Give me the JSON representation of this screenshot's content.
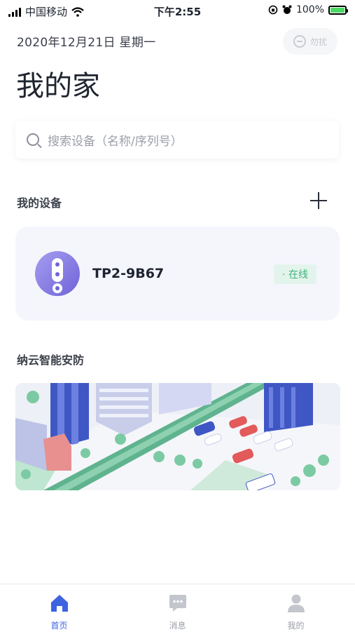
{
  "status_bar": {
    "carrier": "中国移动",
    "time": "下午2:55",
    "battery": "100%"
  },
  "header": {
    "date": "2020年12月21日  星期一",
    "dnd_label": "勿扰",
    "title": "我的家"
  },
  "search": {
    "placeholder": "搜索设备（名称/序列号）"
  },
  "devices_section": {
    "title": "我的设备",
    "devices": [
      {
        "name": "TP2-9B67",
        "status": "· 在线"
      }
    ]
  },
  "security_section": {
    "title": "纳云智能安防"
  },
  "tab_bar": {
    "tabs": [
      {
        "label": "首页",
        "icon": "home-icon",
        "active": true
      },
      {
        "label": "消息",
        "icon": "message-icon",
        "active": false
      },
      {
        "label": "我的",
        "icon": "profile-icon",
        "active": false
      }
    ]
  },
  "colors": {
    "accent": "#3d63e0",
    "online": "#3db27a",
    "card_bg": "#f4f6fc"
  }
}
